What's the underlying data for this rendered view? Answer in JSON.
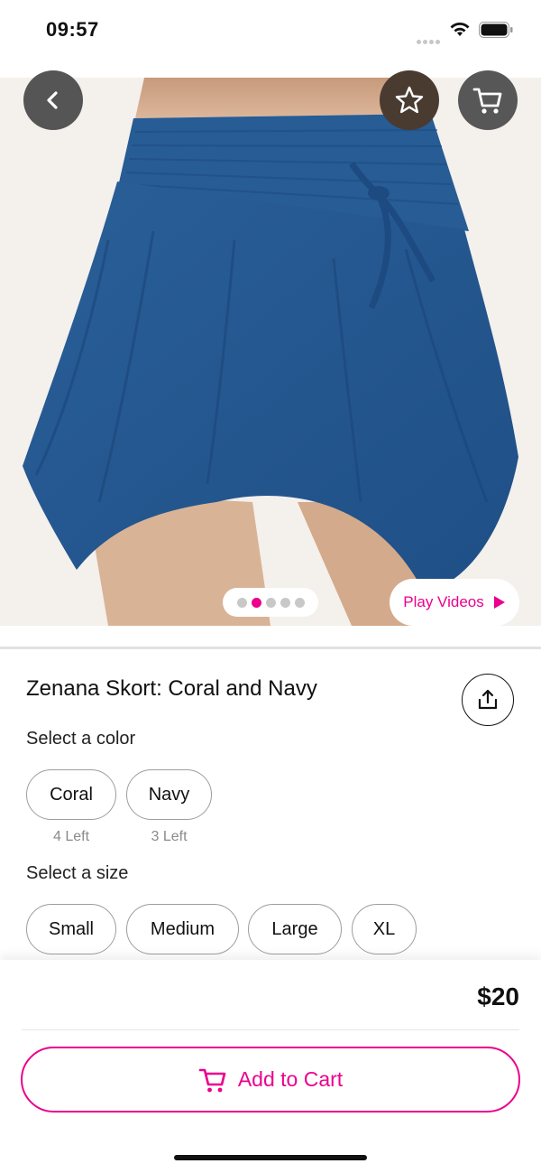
{
  "status_bar": {
    "time": "09:57"
  },
  "hero": {
    "active_image_index": 1,
    "image_count": 5,
    "play_videos_label": "Play Videos"
  },
  "product": {
    "title": "Zenana Skort: Coral and Navy",
    "price": "$20"
  },
  "color_select": {
    "label": "Select a color",
    "options": [
      {
        "name": "Coral",
        "stock": "4 Left"
      },
      {
        "name": "Navy",
        "stock": "3 Left"
      }
    ]
  },
  "size_select": {
    "label": "Select a size",
    "options": [
      "Small",
      "Medium",
      "Large",
      "XL"
    ]
  },
  "actions": {
    "add_to_cart_label": "Add to Cart"
  },
  "colors": {
    "accent": "#ec008c",
    "skirt": "#25578f",
    "background": "#ffffff"
  }
}
